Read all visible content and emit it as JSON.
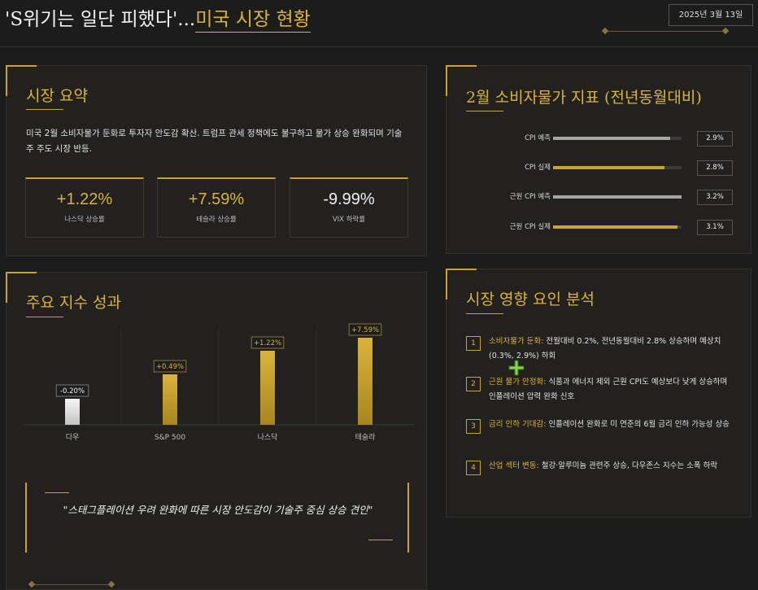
{
  "header": {
    "title_prefix": "'S위기는 일단 피했다'...",
    "title_highlight": "미국 시장 현황",
    "date": "2025년 3월 13일"
  },
  "summary": {
    "title": "시장 요약",
    "text": "미국 2월 소비자물가 둔화로 투자자 안도감 확산. 트럼프 관세 정책에도 불구하고 물가 상승 완화되며 기술주 주도 시장 반등.",
    "stats": [
      {
        "value": "+1.22%",
        "label": "나스닥 상승률"
      },
      {
        "value": "+7.59%",
        "label": "테슬라 상승률"
      },
      {
        "value": "-9.99%",
        "label": "VIX 하락률"
      }
    ]
  },
  "cpi": {
    "title": "2월 소비자물가 지표 (전년동월대비)",
    "rows": [
      {
        "label": "CPI 예측",
        "value": "2.9%",
        "fill": 0.91,
        "color": "#a6a6a6"
      },
      {
        "label": "CPI 실제",
        "value": "2.8%",
        "fill": 0.87,
        "color": "#c9a233"
      },
      {
        "label": "근원 CPI 예측",
        "value": "3.2%",
        "fill": 1.0,
        "color": "#a6a6a6"
      },
      {
        "label": "근원 CPI 실제",
        "value": "3.1%",
        "fill": 0.97,
        "color": "#c9a233"
      }
    ]
  },
  "index_perf": {
    "title": "주요 지수 성과",
    "quote": "\"스태그플레이션 우려 완화에 따른 시장 안도감이 기술주 중심 상승 견인\""
  },
  "chart_data": {
    "type": "bar",
    "categories": [
      "다우",
      "S&P 500",
      "나스닥",
      "테슬라"
    ],
    "values": [
      -0.2,
      0.49,
      1.22,
      7.59
    ],
    "value_labels": [
      "-0.20%",
      "+0.49%",
      "+1.22%",
      "+7.59%"
    ],
    "colors": {
      "negative": "#e8e8e8",
      "positive": "#c9a233"
    }
  },
  "factors": {
    "title": "시장 영향 요인 분석",
    "items": [
      {
        "num": "1",
        "key": "소비자물가 둔화:",
        "text": " 전월대비 0.2%, 전년동월대비 2.8% 상승하며 예상치(0.3%, 2.9%) 하회"
      },
      {
        "num": "2",
        "key": "근원 물가 안정화:",
        "text": " 식품과 에너지 제외 근원 CPI도 예상보다 낮게 상승하며 인플레이션 압력 완화 신호"
      },
      {
        "num": "3",
        "key": "금리 인하 기대감:",
        "text": " 인플레이션 완화로 미 연준의 6월 금리 인하 가능성 상승"
      },
      {
        "num": "4",
        "key": "산업 섹터 변동:",
        "text": " 철강·알루미늄 관련주 상승, 다우존스 지수는 소폭 하락"
      }
    ]
  }
}
